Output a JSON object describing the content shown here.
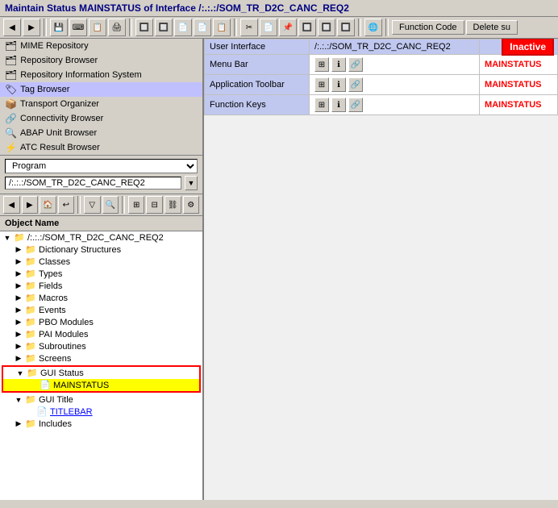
{
  "title": {
    "text": "Maintain Status MAINSTATUS of Interface /:.:.:/SOM_TR_D2C_CANC_REQ2"
  },
  "toolbar": {
    "function_code_label": "Function Code",
    "delete_label": "Delete su"
  },
  "left_nav": {
    "items": [
      {
        "id": "mime-repo",
        "label": "MIME Repository",
        "icon": "🗂"
      },
      {
        "id": "repo-browser",
        "label": "Repository Browser",
        "icon": "🗂"
      },
      {
        "id": "repo-info",
        "label": "Repository Information System",
        "icon": "🗂"
      },
      {
        "id": "tag-browser",
        "label": "Tag Browser",
        "icon": "🏷",
        "active": true
      },
      {
        "id": "transport",
        "label": "Transport Organizer",
        "icon": "📦"
      },
      {
        "id": "connectivity",
        "label": "Connectivity Browser",
        "icon": "🔗"
      },
      {
        "id": "abap-unit",
        "label": "ABAP Unit Browser",
        "icon": "🔍"
      },
      {
        "id": "atc-result",
        "label": "ATC Result Browser",
        "icon": "⚡"
      }
    ]
  },
  "program_area": {
    "dropdown_label": "Program",
    "input_value": "/:.:.:/SOM_TR_D2C_CANC_REQ2"
  },
  "object_name_label": "Object Name",
  "tree": {
    "root": "/:.:.:/SOM_TR_D2C_CANC_REQ2",
    "items": [
      {
        "id": "dict-structures",
        "label": "Dictionary Structures",
        "indent": 2,
        "type": "folder",
        "expanded": false
      },
      {
        "id": "classes",
        "label": "Classes",
        "indent": 2,
        "type": "folder",
        "expanded": false
      },
      {
        "id": "types",
        "label": "Types",
        "indent": 2,
        "type": "folder",
        "expanded": false
      },
      {
        "id": "fields",
        "label": "Fields",
        "indent": 2,
        "type": "folder",
        "expanded": false
      },
      {
        "id": "macros",
        "label": "Macros",
        "indent": 2,
        "type": "folder",
        "expanded": false
      },
      {
        "id": "events",
        "label": "Events",
        "indent": 2,
        "type": "folder",
        "expanded": false
      },
      {
        "id": "pbo-modules",
        "label": "PBO Modules",
        "indent": 2,
        "type": "folder",
        "expanded": false
      },
      {
        "id": "pai-modules",
        "label": "PAI Modules",
        "indent": 2,
        "type": "folder",
        "expanded": false
      },
      {
        "id": "subroutines",
        "label": "Subroutines",
        "indent": 2,
        "type": "folder",
        "expanded": false
      },
      {
        "id": "screens",
        "label": "Screens",
        "indent": 2,
        "type": "folder",
        "expanded": false
      },
      {
        "id": "gui-status",
        "label": "GUI Status",
        "indent": 2,
        "type": "folder",
        "expanded": true,
        "selected_group": true
      },
      {
        "id": "mainstatus",
        "label": "MAINSTATUS",
        "indent": 3,
        "type": "item",
        "selected": true
      },
      {
        "id": "gui-title",
        "label": "GUI Title",
        "indent": 2,
        "type": "folder",
        "expanded": true
      },
      {
        "id": "titlebar",
        "label": "TITLEBAR",
        "indent": 3,
        "type": "item",
        "link": true
      },
      {
        "id": "includes",
        "label": "Includes",
        "indent": 2,
        "type": "folder",
        "expanded": false
      }
    ]
  },
  "right_panel": {
    "rows": [
      {
        "id": "user-interface",
        "label": "User Interface",
        "value": "/:.:.:/SOM_TR_D2C_CANC_REQ2",
        "badge": "Inactive",
        "type": "header"
      },
      {
        "id": "menu-bar",
        "label": "Menu Bar",
        "value": "MAINSTATUS",
        "icons": [
          "box-icon",
          "info-icon",
          "link-icon"
        ],
        "type": "data"
      },
      {
        "id": "app-toolbar",
        "label": "Application Toolbar",
        "value": "MAINSTATUS",
        "icons": [
          "box-icon",
          "info-icon",
          "link-icon"
        ],
        "type": "data"
      },
      {
        "id": "function-keys",
        "label": "Function Keys",
        "value": "MAINSTATUS",
        "icons": [
          "box-icon",
          "info-icon",
          "link-icon"
        ],
        "type": "data"
      }
    ]
  }
}
